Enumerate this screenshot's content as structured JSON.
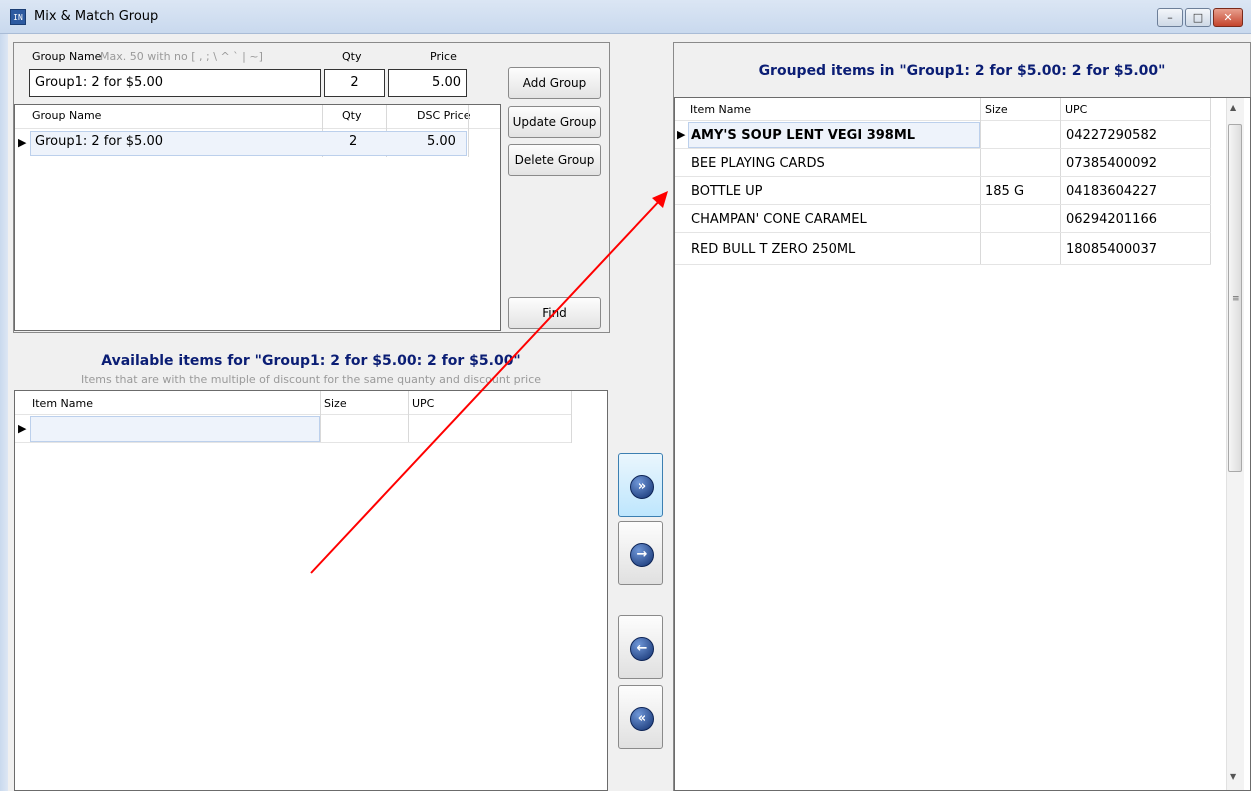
{
  "window": {
    "title": "Mix & Match Group",
    "icon": "app-icon",
    "icon_text": "IN",
    "controls": {
      "minimize": "–",
      "maximize": "□",
      "close": "✕"
    }
  },
  "group_form": {
    "group_name_label": "Group Name",
    "group_name_hint": "Max. 50 with no [ , ; \\ ^ ` | ~]",
    "qty_label": "Qty",
    "price_label": "Price",
    "group_name_value": "Group1: 2 for $5.00",
    "qty_value": "2",
    "price_value": "5.00"
  },
  "buttons": {
    "add_group": "Add Group",
    "update_group": "Update Group",
    "delete_group": "Delete Group",
    "find": "Find"
  },
  "groups_grid": {
    "columns": [
      "Group Name",
      "Qty",
      "DSC Price"
    ],
    "rows": [
      {
        "name": "Group1: 2 for $5.00",
        "qty": "2",
        "price": "5.00"
      }
    ]
  },
  "available": {
    "title": "Available items for \"Group1: 2 for $5.00: 2 for $5.00\"",
    "subtitle": "Items that are with the multiple of discount for the same quanty and discount price",
    "columns": [
      "Item Name",
      "Size",
      "UPC"
    ],
    "rows": []
  },
  "grouped": {
    "title": "Grouped items in \"Group1: 2 for $5.00: 2 for $5.00\"",
    "columns": [
      "Item Name",
      "Size",
      "UPC"
    ],
    "rows": [
      {
        "name": "AMY'S SOUP LENT VEGI 398ML",
        "size": "",
        "upc": "04227290582"
      },
      {
        "name": "BEE PLAYING CARDS",
        "size": "",
        "upc": "07385400092"
      },
      {
        "name": "BOTTLE UP",
        "size": "185 G",
        "upc": "04183604227"
      },
      {
        "name": "CHAMPAN' CONE CARAMEL",
        "size": "",
        "upc": "06294201166"
      },
      {
        "name": "RED BULL T ZERO 250ML",
        "size": "",
        "upc": "18085400037"
      }
    ]
  },
  "transfer_buttons": {
    "move_all_right": "»",
    "move_right": "→",
    "move_left": "←",
    "move_all_left": "«"
  },
  "annotation": {
    "color": "#ff0000"
  }
}
